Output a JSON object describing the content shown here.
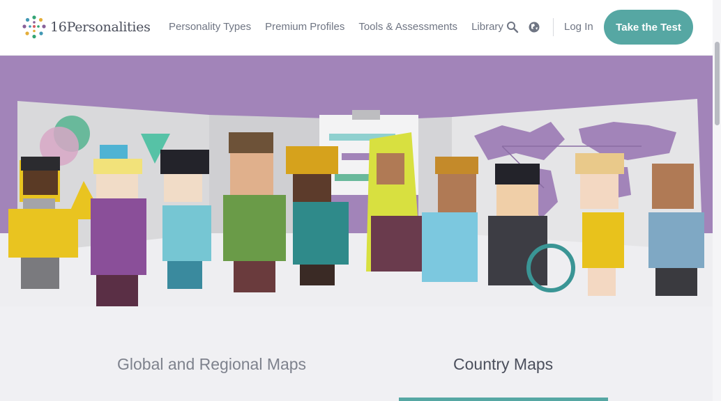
{
  "header": {
    "logo_text": "16Personalities",
    "nav": [
      "Personality Types",
      "Premium Profiles",
      "Tools & Assessments",
      "Library"
    ],
    "login_label": "Log In",
    "cta_label": "Take the Test",
    "icons": [
      "search-icon",
      "globe-icon"
    ]
  },
  "tabs": {
    "global_label": "Global and Regional Maps",
    "country_label": "Country Maps",
    "active": "Country Maps"
  },
  "colors": {
    "accent": "#56a7a3",
    "hero_band": "#a284b9",
    "hero_floor": "#eeeef1"
  }
}
